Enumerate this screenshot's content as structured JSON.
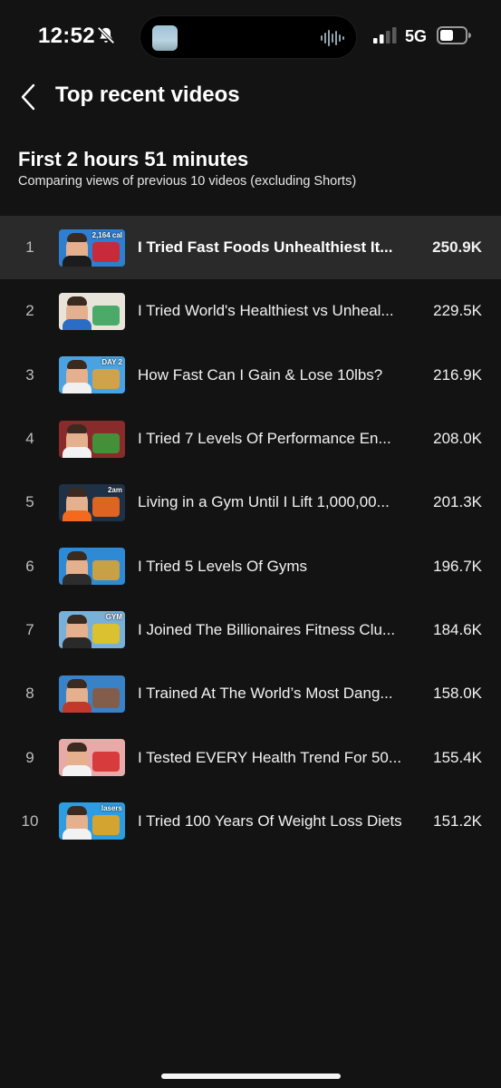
{
  "status_bar": {
    "time": "12:52",
    "network": "5G"
  },
  "header": {
    "title": "Top recent videos"
  },
  "section": {
    "title": "First 2 hours 51 minutes",
    "subtitle": "Comparing views of previous 10 videos (excluding Shorts)"
  },
  "videos": [
    {
      "rank": "1",
      "title": "I Tried Fast Foods Unhealthiest It...",
      "views": "250.9K",
      "selected": true,
      "thumb_text": "2,164 cal"
    },
    {
      "rank": "2",
      "title": "I Tried World's Healthiest vs Unheal...",
      "views": "229.5K",
      "selected": false,
      "thumb_text": ""
    },
    {
      "rank": "3",
      "title": "How Fast Can I Gain & Lose 10lbs?",
      "views": "216.9K",
      "selected": false,
      "thumb_text": "DAY 2"
    },
    {
      "rank": "4",
      "title": "I Tried 7 Levels Of Performance En...",
      "views": "208.0K",
      "selected": false,
      "thumb_text": ""
    },
    {
      "rank": "5",
      "title": "Living in a Gym Until I Lift 1,000,00...",
      "views": "201.3K",
      "selected": false,
      "thumb_text": "2am"
    },
    {
      "rank": "6",
      "title": "I Tried 5 Levels Of Gyms",
      "views": "196.7K",
      "selected": false,
      "thumb_text": ""
    },
    {
      "rank": "7",
      "title": "I Joined The Billionaires Fitness Clu...",
      "views": "184.6K",
      "selected": false,
      "thumb_text": "GYM"
    },
    {
      "rank": "8",
      "title": "I Trained At The World’s Most Dang...",
      "views": "158.0K",
      "selected": false,
      "thumb_text": ""
    },
    {
      "rank": "9",
      "title": "I Tested EVERY Health Trend For 50...",
      "views": "155.4K",
      "selected": false,
      "thumb_text": ""
    },
    {
      "rank": "10",
      "title": "I Tried 100 Years Of Weight Loss Diets",
      "views": "151.2K",
      "selected": false,
      "thumb_text": "lasers"
    }
  ],
  "thumb_colors": [
    {
      "bg": "#2e7fd0",
      "shirt": "#1c1c1c",
      "accent": "#d8222a"
    },
    {
      "bg": "#e9e4da",
      "shirt": "#2b6cc4",
      "accent": "#3aa35b"
    },
    {
      "bg": "#4aa3e0",
      "shirt": "#f0f0f0",
      "accent": "#e0a23a"
    },
    {
      "bg": "#8a2b2b",
      "shirt": "#f2f2f2",
      "accent": "#3c9b3a"
    },
    {
      "bg": "#1e3146",
      "shirt": "#f36a1e",
      "accent": "#f36a1e"
    },
    {
      "bg": "#2f8ad6",
      "shirt": "#2d2d2d",
      "accent": "#d9a236"
    },
    {
      "bg": "#78b0d8",
      "shirt": "#2a2a2a",
      "accent": "#e6c21e"
    },
    {
      "bg": "#3a82c8",
      "shirt": "#c0392b",
      "accent": "#8b5a3c"
    },
    {
      "bg": "#e8a9a9",
      "shirt": "#f2f2f2",
      "accent": "#d62f2f"
    },
    {
      "bg": "#2d9ce0",
      "shirt": "#f2f2f2",
      "accent": "#e5a51c"
    }
  ]
}
